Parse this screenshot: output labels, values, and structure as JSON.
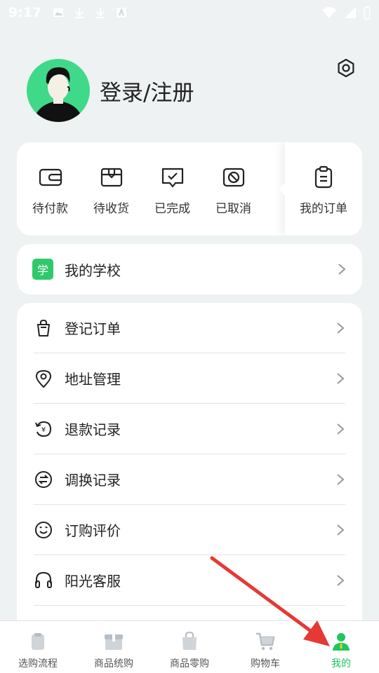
{
  "status_bar": {
    "time": "9:17",
    "icons": [
      "image-icon",
      "download-icon",
      "download-icon",
      "app-icon"
    ],
    "right_icons": [
      "wifi-icon",
      "signal-icon",
      "battery-icon"
    ]
  },
  "profile": {
    "login_text": "登录/注册"
  },
  "orders": {
    "items": [
      {
        "label": "待付款",
        "icon": "wallet-icon"
      },
      {
        "label": "待收货",
        "icon": "package-icon"
      },
      {
        "label": "已完成",
        "icon": "check-chat-icon"
      },
      {
        "label": "已取消",
        "icon": "cancel-icon"
      }
    ],
    "my_orders_label": "我的订单"
  },
  "school": {
    "badge": "学",
    "label": "我的学校"
  },
  "menu": {
    "items": [
      {
        "label": "登记订单",
        "icon": "bag-icon"
      },
      {
        "label": "地址管理",
        "icon": "location-icon"
      },
      {
        "label": "退款记录",
        "icon": "refund-icon"
      },
      {
        "label": "调换记录",
        "icon": "exchange-icon"
      },
      {
        "label": "订购评价",
        "icon": "smile-icon"
      },
      {
        "label": "阳光客服",
        "icon": "headset-icon"
      }
    ]
  },
  "tabbar": {
    "tabs": [
      {
        "label": "选购流程",
        "icon": "clipboard-icon",
        "active": false
      },
      {
        "label": "商品统购",
        "icon": "box-icon",
        "active": false
      },
      {
        "label": "商品零购",
        "icon": "shopping-bag-icon",
        "active": false
      },
      {
        "label": "购物车",
        "icon": "cart-icon",
        "active": false
      },
      {
        "label": "我的",
        "icon": "user-icon",
        "active": true
      }
    ]
  },
  "colors": {
    "accent": "#22c55e",
    "avatar_bg": "#3fd98a",
    "background": "#eef2f2",
    "arrow": "#e53935"
  }
}
